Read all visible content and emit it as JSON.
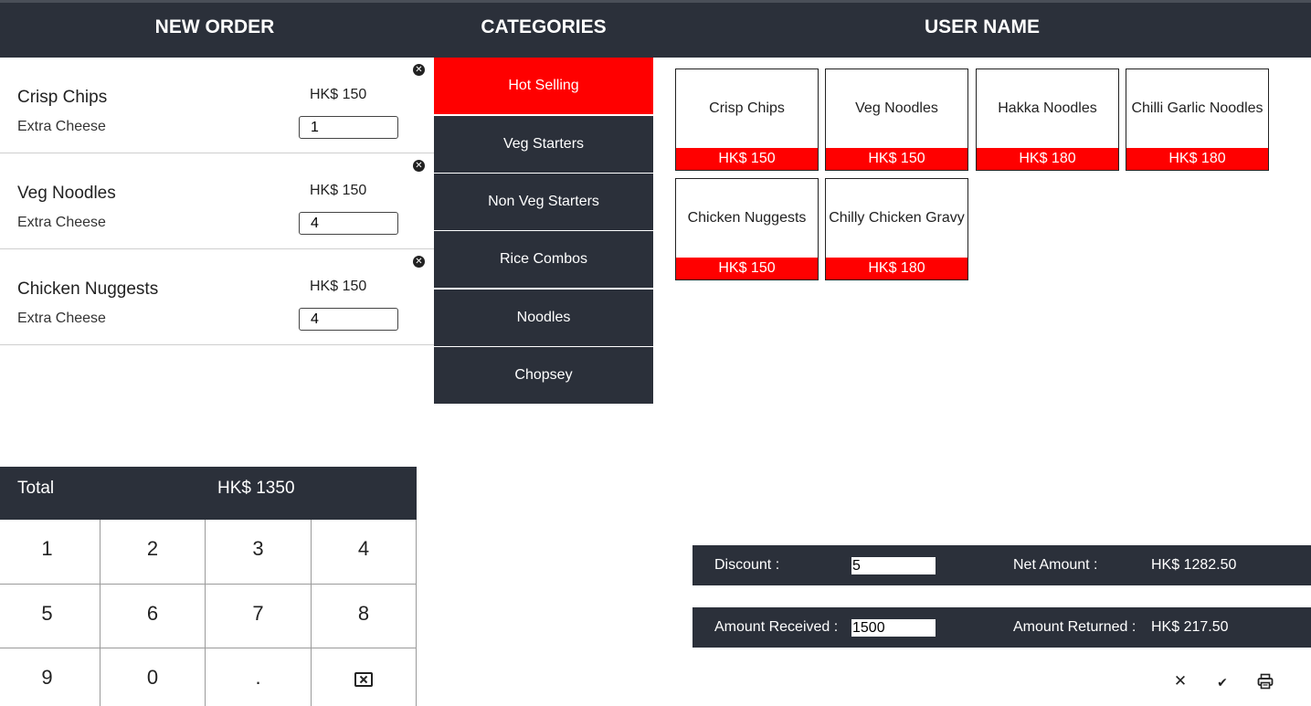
{
  "header": {
    "new_order": "NEW ORDER",
    "categories": "CATEGORIES",
    "user_name": "USER NAME"
  },
  "order": {
    "items": [
      {
        "name": "Crisp Chips",
        "extra": "Extra Cheese",
        "price": "HK$ 150",
        "qty": "1"
      },
      {
        "name": "Veg Noodles",
        "extra": "Extra Cheese",
        "price": "HK$ 150",
        "qty": "4"
      },
      {
        "name": "Chicken Nuggests",
        "extra": "Extra Cheese",
        "price": "HK$ 150",
        "qty": "4"
      }
    ],
    "remove_icon": "close-circle-icon"
  },
  "categories": [
    {
      "label": "Hot Selling",
      "active": true
    },
    {
      "label": "Veg Starters",
      "active": false
    },
    {
      "label": "Non Veg Starters",
      "active": false
    },
    {
      "label": "Rice Combos",
      "active": false
    },
    {
      "label": "Noodles",
      "active": false
    },
    {
      "label": "Chopsey",
      "active": false
    }
  ],
  "products": [
    {
      "name": "Crisp Chips",
      "price": "HK$ 150"
    },
    {
      "name": "Veg Noodles",
      "price": "HK$ 150"
    },
    {
      "name": "Hakka Noodles",
      "price": "HK$ 180"
    },
    {
      "name": "Chilli Garlic Noodles",
      "price": "HK$ 180"
    },
    {
      "name": "Chicken Nuggests",
      "price": "HK$ 150"
    },
    {
      "name": "Chilly Chicken Gravy",
      "price": "HK$ 180"
    }
  ],
  "total": {
    "label": "Total",
    "value": "HK$ 1350"
  },
  "keypad": [
    "1",
    "2",
    "3",
    "4",
    "5",
    "6",
    "7",
    "8",
    "9",
    "0",
    ".",
    ""
  ],
  "keypad_delete_icon": "backspace-icon",
  "summary": {
    "discount_label": "Discount :",
    "discount_value": "5",
    "net_amount_label": "Net Amount :",
    "net_amount_value": "HK$ 1282.50",
    "amount_received_label": "Amount Received :",
    "amount_received_value": "1500",
    "amount_returned_label": "Amount Returned :",
    "amount_returned_value": "HK$ 217.50"
  },
  "actions": {
    "close_glyph": "✕",
    "check_glyph": "✔",
    "icons": [
      "close-icon",
      "check-icon",
      "printer-icon"
    ]
  },
  "colors": {
    "header_bg": "#2b303a",
    "accent": "#ff0000",
    "text": "#222222"
  }
}
